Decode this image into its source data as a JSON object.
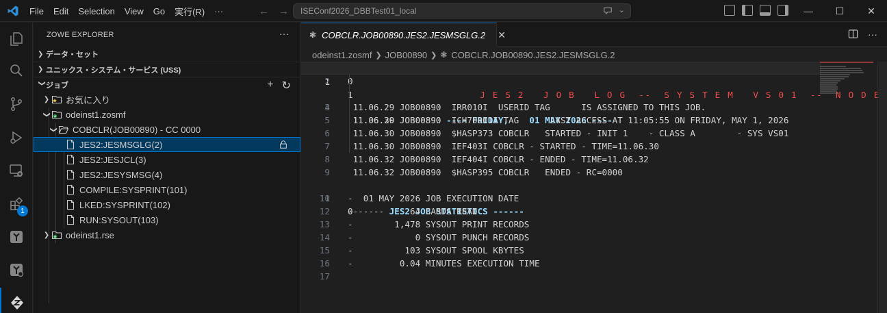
{
  "titlebar": {
    "menu": [
      "File",
      "Edit",
      "Selection",
      "View",
      "Go",
      "実行(R)",
      "···"
    ],
    "search_text": "ISEConf2026_DBBTest01_local"
  },
  "activity": {
    "extensions_badge": "1"
  },
  "sidebar": {
    "title": "ZOWE EXPLORER",
    "sections": {
      "datasets": "データ・セット",
      "uss": "ユニックス・システム・サービス (USS)",
      "jobs": "ジョブ"
    },
    "tree": {
      "favorites": "お気に入り",
      "profile1": "odeinst1.zosmf",
      "job": "COBCLR(JOB00890) - CC 0000",
      "spool": [
        "JES2:JESMSGLG(2)",
        "JES2:JESJCL(3)",
        "JES2:JESYSMSG(4)",
        "COMPILE:SYSPRINT(101)",
        "LKED:SYSPRINT(102)",
        "RUN:SYSOUT(103)"
      ],
      "profile2": "odeinst1.rse"
    }
  },
  "editor": {
    "tab_label": "COBCLR.JOB00890.JES2.JESMSGLG.2",
    "breadcrumb": [
      "odeinst1.zosmf",
      "JOB00890",
      "COBCLR.JOB00890.JES2.JESMSGLG.2"
    ],
    "lines": [
      {
        "n": "1",
        "pre": "1",
        "hdr": "                    J E S 2   J O B   L O G  --  S Y S T E M   V S 0 1  --  N O D E   "
      },
      {
        "n": "2",
        "t": "0"
      },
      {
        "n": "3",
        "pre": " 11.06.29 JOB00890 ",
        "kw": "---- FRIDAY,    01 MAY 2026 ----"
      },
      {
        "n": "4",
        "t": " 11.06.29 JOB00890  IRR010I  USERID TAG      IS ASSIGNED TO THIS JOB."
      },
      {
        "n": "5",
        "t": " 11.06.30 JOB00890  ICH70001I TAG      LAST ACCESS AT 11:05:55 ON FRIDAY, MAY 1, 2026"
      },
      {
        "n": "6",
        "t": " 11.06.30 JOB00890  $HASP373 COBCLR   STARTED - INIT 1    - CLASS A        - SYS VS01"
      },
      {
        "n": "7",
        "t": " 11.06.30 JOB00890  IEF403I COBCLR - STARTED - TIME=11.06.30"
      },
      {
        "n": "8",
        "t": " 11.06.32 JOB00890  IEF404I COBCLR - ENDED - TIME=11.06.32"
      },
      {
        "n": "9",
        "t": " 11.06.32 JOB00890  $HASP395 COBCLR   ENDED - RC=0000"
      },
      {
        "n": "10",
        "pre": "0------ ",
        "kw": "JES2 JOB STATISTICS ------"
      },
      {
        "n": "11",
        "t": "-  01 MAY 2026 JOB EXECUTION DATE"
      },
      {
        "n": "12",
        "t": "-           64 CARDS READ"
      },
      {
        "n": "13",
        "t": "-        1,478 SYSOUT PRINT RECORDS"
      },
      {
        "n": "14",
        "t": "-            0 SYSOUT PUNCH RECORDS"
      },
      {
        "n": "15",
        "t": "-          103 SYSOUT SPOOL KBYTES"
      },
      {
        "n": "16",
        "t": "-         0.04 MINUTES EXECUTION TIME"
      },
      {
        "n": "17",
        "t": ""
      }
    ]
  }
}
